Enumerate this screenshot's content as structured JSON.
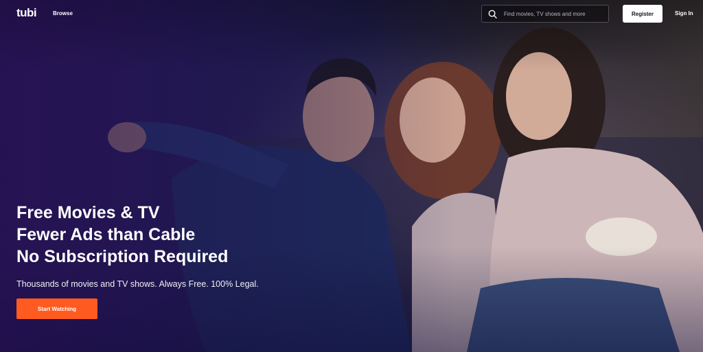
{
  "header": {
    "logo_text": "tubi",
    "nav_browse": "Browse",
    "search": {
      "placeholder": "Find movies, TV shows and more",
      "value": ""
    },
    "register_label": "Register",
    "signin_label": "Sign In"
  },
  "hero": {
    "headline_lines": [
      "Free Movies & TV",
      "Fewer Ads than Cable",
      "No Subscription Required"
    ],
    "subtext": "Thousands of movies and TV shows. Always Free. 100% Legal.",
    "cta_label": "Start Watching",
    "image_description_icon": "friends-watching-tv-image"
  },
  "colors": {
    "accent": "#ff5a1f",
    "register_bg": "#ffffff",
    "hero_tint": "#2a1857"
  }
}
